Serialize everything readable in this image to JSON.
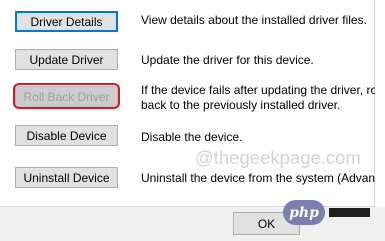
{
  "actions": [
    {
      "button_label": "Driver Details",
      "description": [
        "View details about the installed driver files."
      ],
      "state": "focused"
    },
    {
      "button_label": "Update Driver",
      "description": [
        "Update the driver for this device."
      ],
      "state": "enabled"
    },
    {
      "button_label": "Roll Back Driver",
      "description": [
        "If the device fails after updating the driver, roll",
        "back to the previously installed driver."
      ],
      "state": "disabled"
    },
    {
      "button_label": "Disable Device",
      "description": [
        "Disable the device."
      ],
      "state": "enabled"
    },
    {
      "button_label": "Uninstall Device",
      "description": [
        "Uninstall the device from the system (Advanced)."
      ],
      "state": "enabled"
    }
  ],
  "watermark": "@thegeekpage.com",
  "footer": {
    "ok_label": "OK"
  },
  "php_badge": "php",
  "colors": {
    "highlight_border": "#e0161f",
    "focus_border": "#0078d7",
    "disabled_text": "#a0a0a0",
    "php_badge": "#7b7fb0"
  }
}
